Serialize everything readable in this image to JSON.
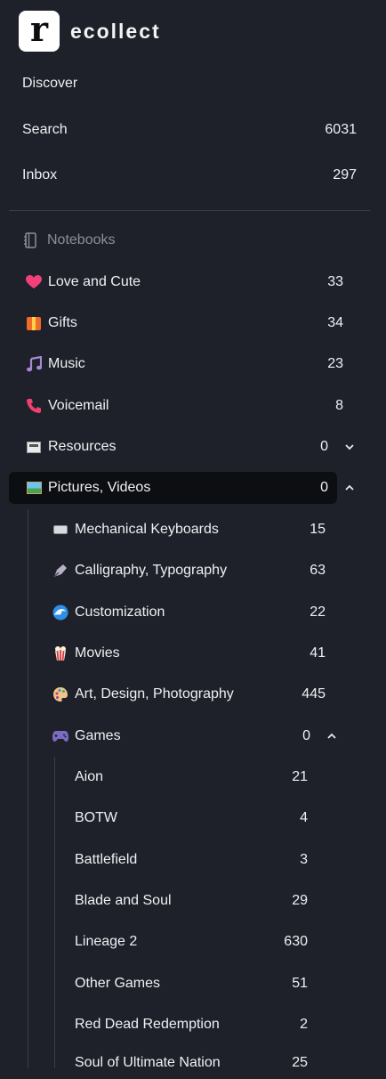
{
  "app": {
    "brand": "ecollect",
    "logo_letter": "r"
  },
  "nav": [
    {
      "label": "Discover",
      "count": ""
    },
    {
      "label": "Search",
      "count": "6031"
    },
    {
      "label": "Inbox",
      "count": "297"
    }
  ],
  "notebooks_heading": "Notebooks",
  "notebooks": [
    {
      "label": "Love and Cute",
      "count": "33",
      "icon": "heart-icon"
    },
    {
      "label": "Gifts",
      "count": "34",
      "icon": "gift-icon"
    },
    {
      "label": "Music",
      "count": "23",
      "icon": "music-note-icon"
    },
    {
      "label": "Voicemail",
      "count": "8",
      "icon": "telephone-icon"
    },
    {
      "label": "Resources",
      "count": "0",
      "icon": "newspaper-icon",
      "expand": "collapsed"
    },
    {
      "label": "Pictures, Videos",
      "count": "0",
      "icon": "framed-picture-icon",
      "expand": "expanded"
    }
  ],
  "pictures_children": [
    {
      "label": "Mechanical Keyboards",
      "count": "15",
      "icon": "keyboard-icon"
    },
    {
      "label": "Calligraphy, Typography",
      "count": "63",
      "icon": "fountain-pen-icon"
    },
    {
      "label": "Customization",
      "count": "22",
      "icon": "wave-icon"
    },
    {
      "label": "Movies",
      "count": "41",
      "icon": "popcorn-icon"
    },
    {
      "label": "Art, Design, Photography",
      "count": "445",
      "icon": "palette-icon"
    },
    {
      "label": "Games",
      "count": "0",
      "icon": "gamepad-icon",
      "expand": "expanded"
    }
  ],
  "games_children": [
    {
      "label": "Aion",
      "count": "21"
    },
    {
      "label": "BOTW",
      "count": "4"
    },
    {
      "label": "Battlefield",
      "count": "3"
    },
    {
      "label": "Blade and Soul",
      "count": "29"
    },
    {
      "label": "Lineage 2",
      "count": "630"
    },
    {
      "label": "Other Games",
      "count": "51"
    },
    {
      "label": "Red Dead Redemption",
      "count": "2"
    },
    {
      "label": "Soul of Ultimate Nation",
      "count": "25"
    }
  ],
  "colors": {
    "background": "#1e2129",
    "selected_row": "#0d0e12",
    "divider": "#3a3e48",
    "muted": "#8b8f98"
  }
}
